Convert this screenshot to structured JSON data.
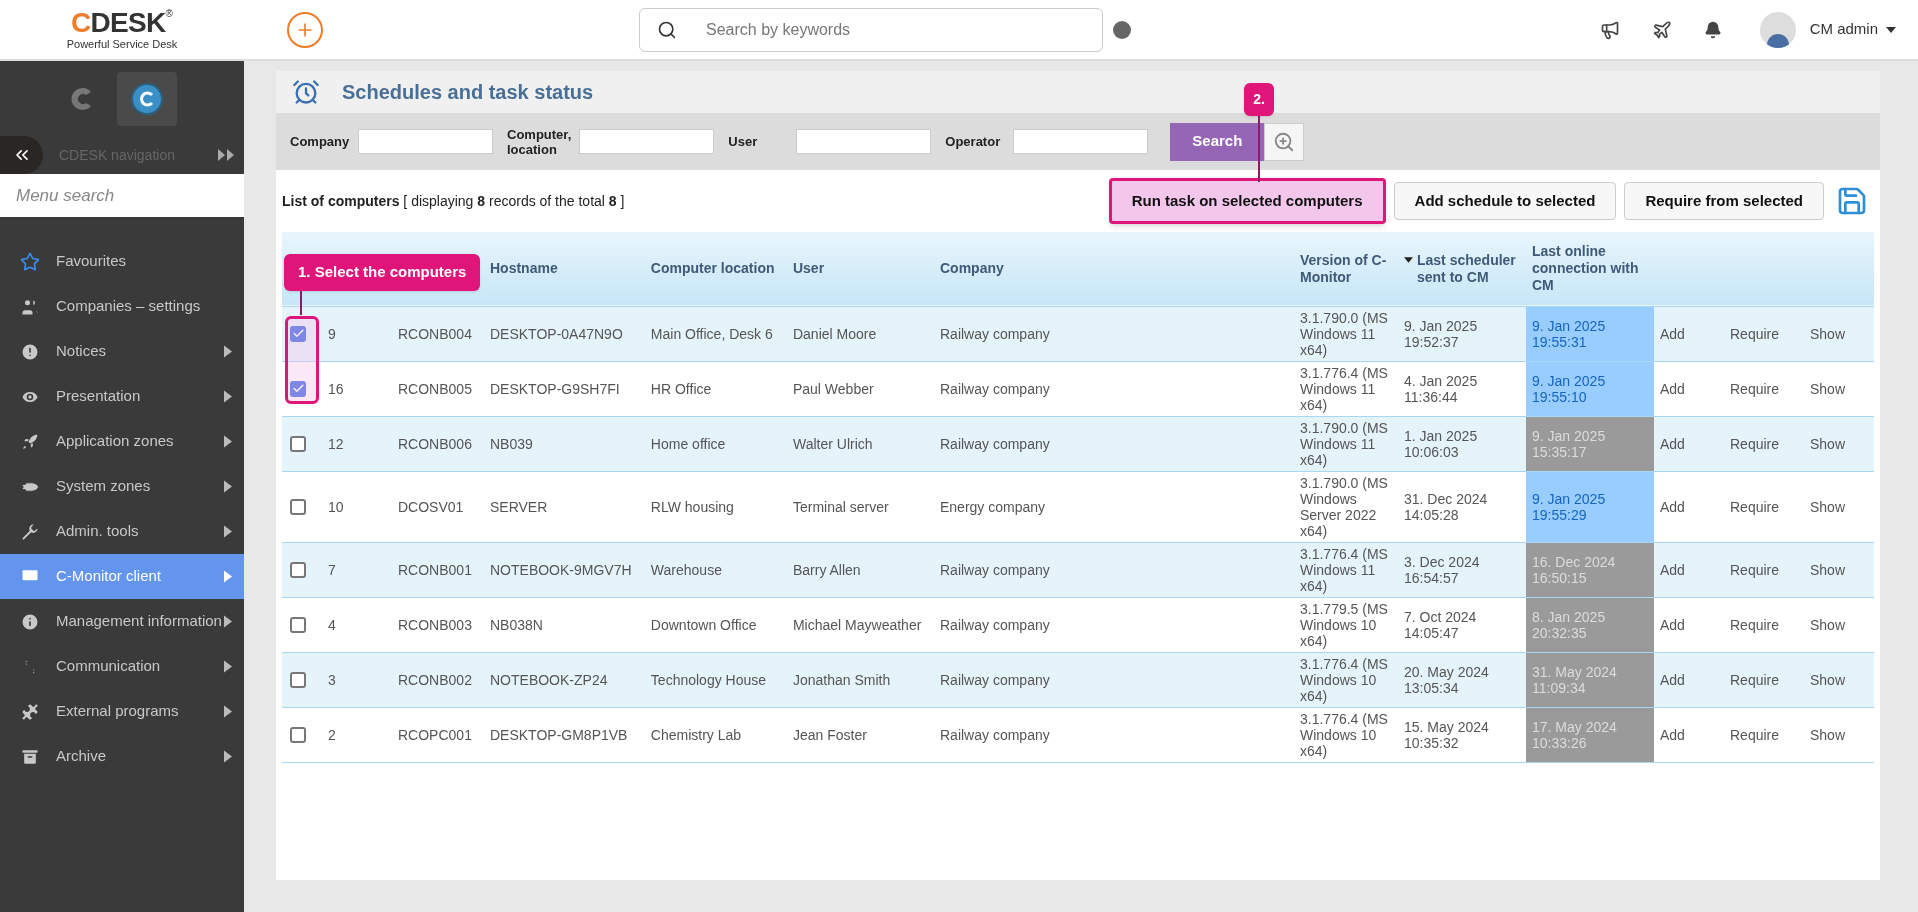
{
  "header": {
    "logo": {
      "letter": "C",
      "name": "DESK",
      "registered": "®",
      "tagline": "Powerful Service Desk"
    },
    "search": {
      "placeholder": "Search by keywords"
    },
    "user": {
      "name": "CM admin"
    }
  },
  "sidebar": {
    "navigation_label": "CDESK navigation",
    "search": {
      "placeholder": "Menu search"
    },
    "items": [
      {
        "label": "Favourites",
        "has_submenu": false,
        "selected": false
      },
      {
        "label": "Companies – settings",
        "has_submenu": false,
        "selected": false
      },
      {
        "label": "Notices",
        "has_submenu": true,
        "selected": false
      },
      {
        "label": "Presentation",
        "has_submenu": true,
        "selected": false
      },
      {
        "label": "Application zones",
        "has_submenu": true,
        "selected": false
      },
      {
        "label": "System zones",
        "has_submenu": true,
        "selected": false
      },
      {
        "label": "Admin. tools",
        "has_submenu": true,
        "selected": false
      },
      {
        "label": "C-Monitor client",
        "has_submenu": true,
        "selected": true
      },
      {
        "label": "Management information",
        "has_submenu": true,
        "selected": false
      },
      {
        "label": "Communication",
        "has_submenu": true,
        "selected": false
      },
      {
        "label": "External programs",
        "has_submenu": true,
        "selected": false
      },
      {
        "label": "Archive",
        "has_submenu": true,
        "selected": false
      }
    ]
  },
  "page": {
    "title": "Schedules and task status",
    "filters": [
      {
        "label": "Company"
      },
      {
        "label": "Computer, location"
      },
      {
        "label": "User"
      },
      {
        "label": "Operator"
      }
    ],
    "search_button": "Search",
    "list_summary": "**List of computers** [ displaying **8** records of the total **8** ]",
    "actions": [
      {
        "label": "Run task on selected computers",
        "highlighted": true
      },
      {
        "label": "Add schedule to selected",
        "highlighted": false
      },
      {
        "label": "Require from selected",
        "highlighted": false
      }
    ],
    "table": {
      "columns": [
        {
          "label": "Hostname",
          "sorted": false
        },
        {
          "label": "Computer location",
          "sorted": false
        },
        {
          "label": "User",
          "sorted": false
        },
        {
          "label": "Company",
          "sorted": false
        },
        {
          "label": "Version of C-Monitor",
          "sorted": false
        },
        {
          "label": "Last scheduler sent to CM",
          "sorted": true
        },
        {
          "label": "Last online connection with CM",
          "sorted": false
        }
      ],
      "rows": [
        {
          "checked": true,
          "id": "9",
          "name": "RCONB004",
          "hostname": "DESKTOP-0A47N9O",
          "location": "Main Office, Desk 6",
          "user": "Daniel Moore",
          "company": "Railway company",
          "version": "3.1.790.0 (MS Windows 11 x64)",
          "last_scheduler": "9. Jan 2025 19:52:37",
          "last_online": "9. Jan 2025 19:55:31",
          "online": true,
          "actions": [
            "Add",
            "Require",
            "Show"
          ]
        },
        {
          "checked": true,
          "id": "16",
          "name": "RCONB005",
          "hostname": "DESKTOP-G9SH7FI",
          "location": "HR Office",
          "user": "Paul Webber",
          "company": "Railway company",
          "version": "3.1.776.4 (MS Windows 11 x64)",
          "last_scheduler": "4. Jan 2025 11:36:44",
          "last_online": "9. Jan 2025 19:55:10",
          "online": true,
          "actions": [
            "Add",
            "Require",
            "Show"
          ]
        },
        {
          "checked": false,
          "id": "12",
          "name": "RCONB006",
          "hostname": "NB039",
          "location": "Home office",
          "user": "Walter Ulrich",
          "company": "Railway company",
          "version": "3.1.790.0 (MS Windows 11 x64)",
          "last_scheduler": "1. Jan 2025 10:06:03",
          "last_online": "9. Jan 2025 15:35:17",
          "online": false,
          "actions": [
            "Add",
            "Require",
            "Show"
          ]
        },
        {
          "checked": false,
          "id": "10",
          "name": "DCOSV01",
          "hostname": "SERVER",
          "location": "RLW housing",
          "user": "Terminal server",
          "company": "Energy company",
          "version": "3.1.790.0 (MS Windows Server 2022 x64)",
          "last_scheduler": "31. Dec 2024 14:05:28",
          "last_online": "9. Jan 2025 19:55:29",
          "online": true,
          "actions": [
            "Add",
            "Require",
            "Show"
          ]
        },
        {
          "checked": false,
          "id": "7",
          "name": "RCONB001",
          "hostname": "NOTEBOOK-9MGV7H",
          "location": "Warehouse",
          "user": "Barry Allen",
          "company": "Railway company",
          "version": "3.1.776.4 (MS Windows 11 x64)",
          "last_scheduler": "3. Dec 2024 16:54:57",
          "last_online": "16. Dec 2024 16:50:15",
          "online": false,
          "actions": [
            "Add",
            "Require",
            "Show"
          ]
        },
        {
          "checked": false,
          "id": "4",
          "name": "RCONB003",
          "hostname": "NB038N",
          "location": "Downtown Office",
          "user": "Michael Mayweather",
          "company": "Railway company",
          "version": "3.1.779.5 (MS Windows 10 x64)",
          "last_scheduler": "7. Oct 2024 14:05:47",
          "last_online": "8. Jan 2025 20:32:35",
          "online": false,
          "actions": [
            "Add",
            "Require",
            "Show"
          ]
        },
        {
          "checked": false,
          "id": "3",
          "name": "RCONB002",
          "hostname": "NOTEBOOK-ZP24",
          "location": "Technology House",
          "user": "Jonathan Smith",
          "company": "Railway company",
          "version": "3.1.776.4 (MS Windows 10 x64)",
          "last_scheduler": "20. May 2024 13:05:34",
          "last_online": "31. May 2024 11:09:34",
          "online": false,
          "actions": [
            "Add",
            "Require",
            "Show"
          ]
        },
        {
          "checked": false,
          "id": "2",
          "name": "RCOPC001",
          "hostname": "DESKTOP-GM8P1VB",
          "location": "Chemistry Lab",
          "user": "Jean Foster",
          "company": "Railway company",
          "version": "3.1.776.4 (MS Windows 10 x64)",
          "last_scheduler": "15. May 2024 10:35:32",
          "last_online": "17. May 2024 10:33:26",
          "online": false,
          "actions": [
            "Add",
            "Require",
            "Show"
          ]
        }
      ]
    }
  },
  "annotations": [
    {
      "label": "1. Select the computers"
    },
    {
      "label": "2."
    }
  ]
}
